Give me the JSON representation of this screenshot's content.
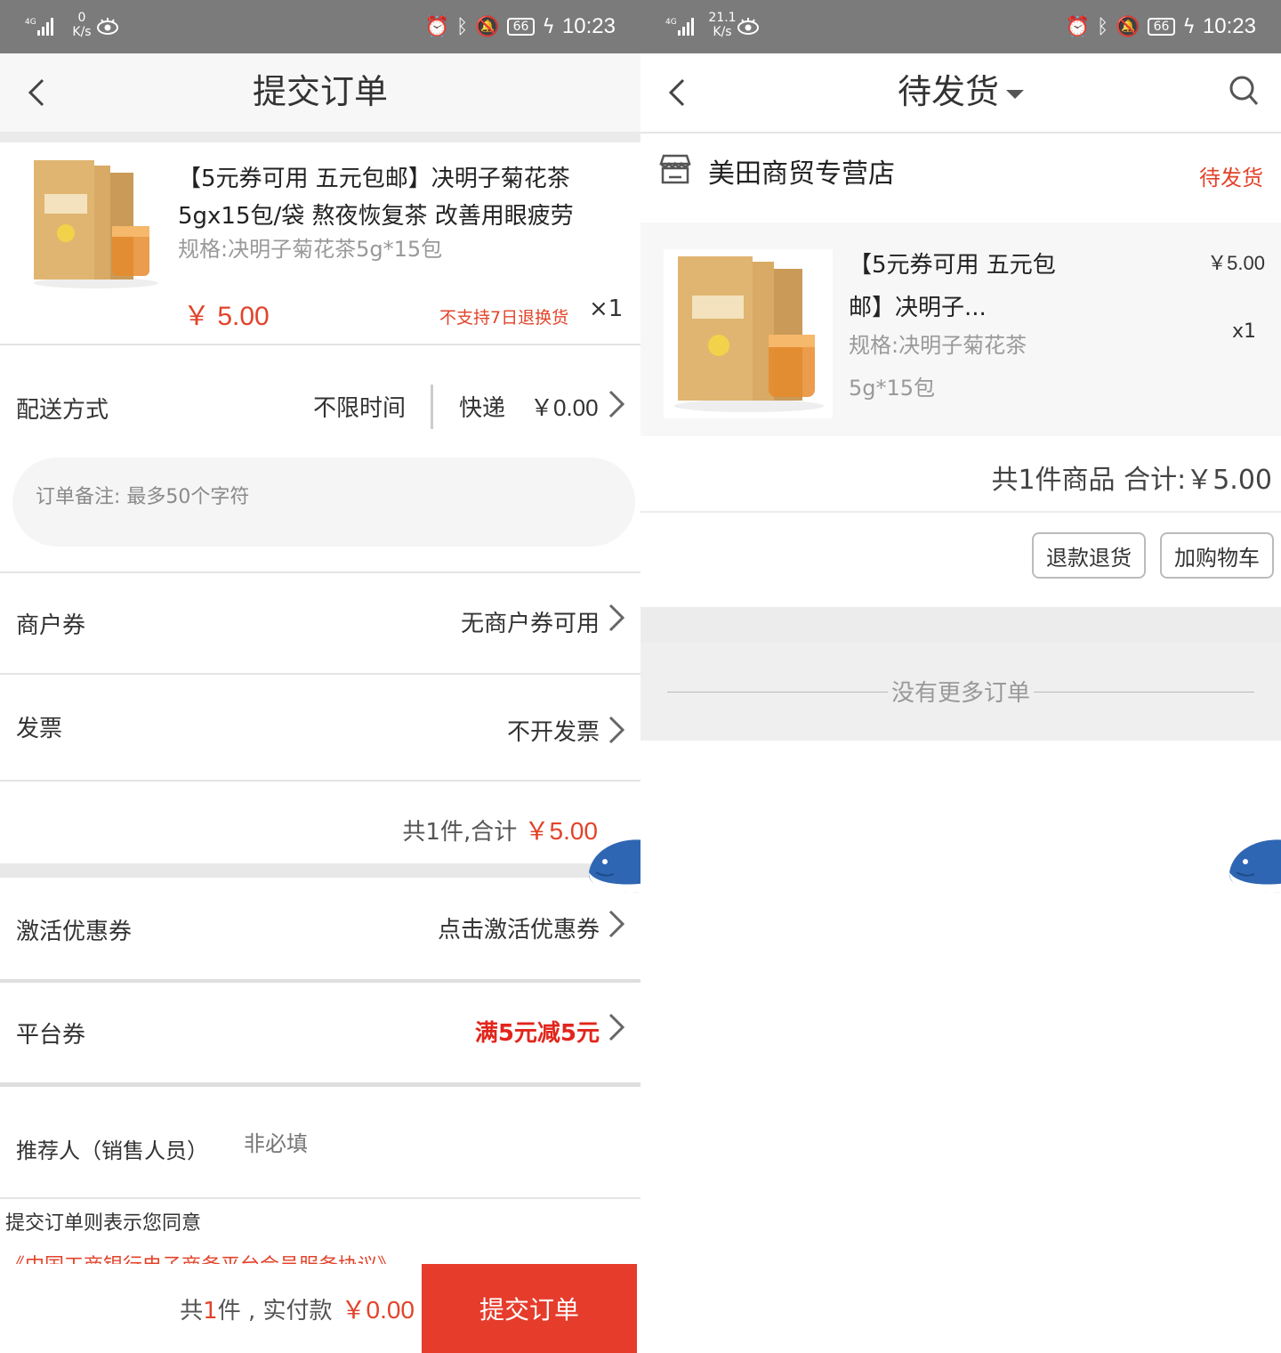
{
  "status_bar": {
    "left": {
      "speed_value": "0",
      "speed_unit": "K/s",
      "network": "4G"
    },
    "right": {
      "speed_value": "21.1",
      "speed_unit": "K/s",
      "network": "4G"
    },
    "battery": "66",
    "time": "10:23"
  },
  "submit_order": {
    "title": "提交订单",
    "product": {
      "name": "【5元券可用 五元包邮】决明子菊花茶5gx15包/袋 熬夜恢复茶 改善用眼疲劳",
      "spec": "规格:决明子菊花茶5g*15包",
      "price": "￥ 5.00",
      "return_policy": "不支持7日退换货",
      "quantity": "×1"
    },
    "delivery": {
      "label": "配送方式",
      "time": "不限时间",
      "method": "快递",
      "fee": "￥0.00"
    },
    "remark_placeholder": "订单备注: 最多50个字符",
    "merchant_coupon": {
      "label": "商户券",
      "value": "无商户券可用"
    },
    "invoice": {
      "label": "发票",
      "value": "不开发票"
    },
    "summary": {
      "count_text": "共1件,合计",
      "amount": "￥5.00"
    },
    "activate_coupon": {
      "label": "激活优惠券",
      "value": "点击激活优惠券"
    },
    "platform_coupon": {
      "label": "平台券",
      "value": "满5元减5元"
    },
    "referrer": {
      "label": "推荐人（销售人员）",
      "placeholder": "非必填"
    },
    "agreement_text": "提交订单则表示您同意",
    "agreement_link": "《中国工商银行电子商务平台会员服务协议》",
    "bottom_bar": {
      "prefix": "共",
      "count": "1",
      "suffix": "件 , 实付款",
      "amount": "￥0.00",
      "submit_label": "提交订单"
    }
  },
  "orders": {
    "title": "待发货",
    "shop": {
      "name": "美田商贸专营店",
      "status": "待发货"
    },
    "item": {
      "name": "【5元券可用 五元包邮】决明子...",
      "spec": "规格:决明子菊花茶5g*15包",
      "price": "￥5.00",
      "quantity": "x1"
    },
    "summary": "共1件商品 合计:￥5.00",
    "actions": {
      "refund": "退款退货",
      "add_cart": "加购物车"
    },
    "no_more": "没有更多订单"
  },
  "colors": {
    "accent": "#e63c2c",
    "status_bar": "#7b7b7b"
  }
}
